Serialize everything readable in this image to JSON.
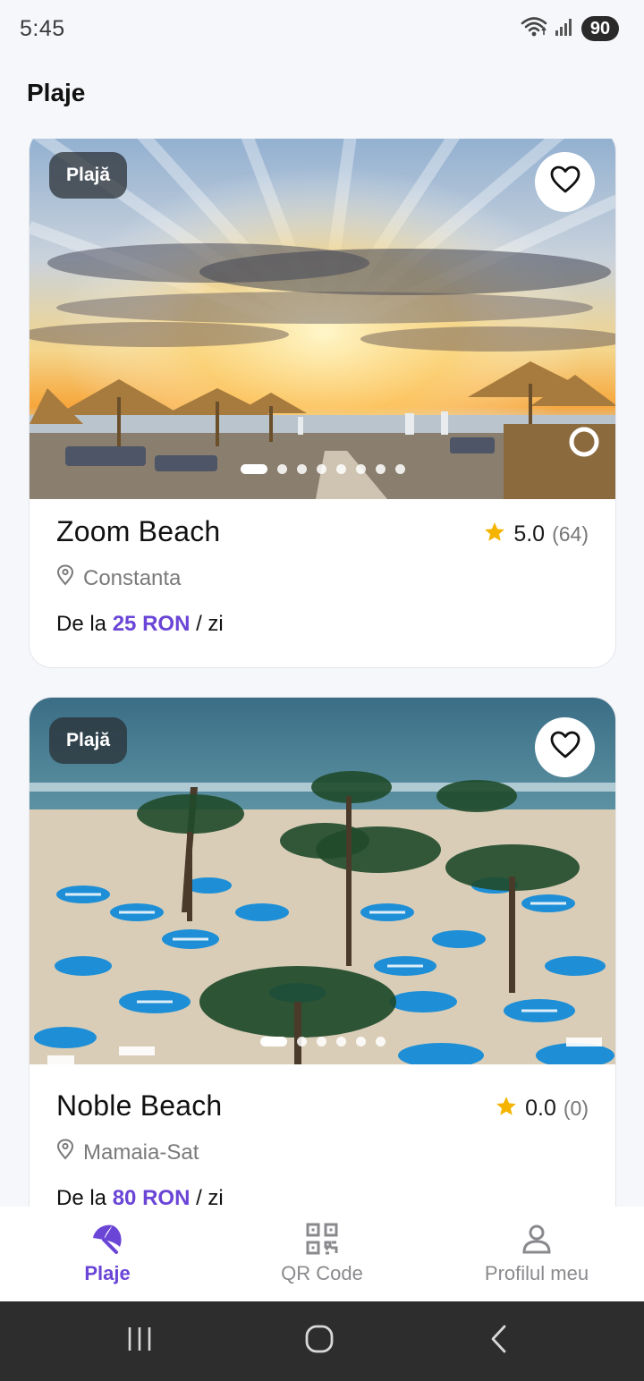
{
  "status_bar": {
    "time": "5:45",
    "battery": "90"
  },
  "header": {
    "title": "Plaje"
  },
  "beaches": [
    {
      "badge": "Plajă",
      "name": "Zoom Beach",
      "rating": "5.0",
      "rating_count": "(64)",
      "location": "Constanta",
      "price_prefix": "De la",
      "price": "25 RON",
      "price_suffix": "/ zi",
      "images_total": 8,
      "image_active": 1
    },
    {
      "badge": "Plajă",
      "name": "Noble Beach",
      "rating": "0.0",
      "rating_count": "(0)",
      "location": "Mamaia-Sat",
      "price_prefix": "De la",
      "price": "80 RON",
      "price_suffix": "/ zi",
      "images_total": 6,
      "image_active": 1
    }
  ],
  "bottom_nav": {
    "items": [
      {
        "label": "Plaje",
        "icon": "beach-umbrella-icon",
        "active": true
      },
      {
        "label": "QR Code",
        "icon": "qr-code-icon",
        "active": false
      },
      {
        "label": "Profilul meu",
        "icon": "user-icon",
        "active": false
      }
    ]
  },
  "colors": {
    "accent": "#6a45d6",
    "star": "#f5b400",
    "background": "#f6f7fa"
  }
}
